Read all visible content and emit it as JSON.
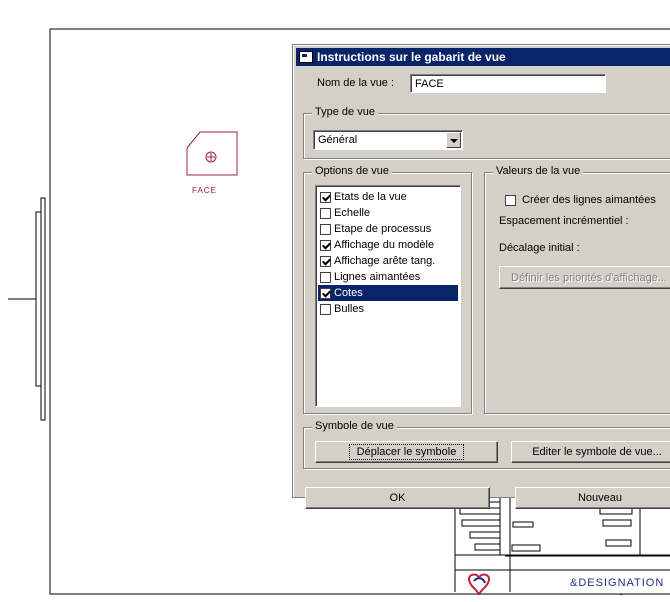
{
  "drawing": {
    "view_label": "FACE",
    "title_block_text": "&DESIGNATION",
    "title_block_dash": "-"
  },
  "dialog": {
    "title": "Instructions sur le gabarit de vue",
    "view_name_label": "Nom de la vue :",
    "view_name_value": "FACE",
    "view_type_group": "Type de vue",
    "view_type_value": "Général",
    "view_options_group": "Options de vue",
    "view_options": [
      {
        "label": "Etats de la vue",
        "checked": true,
        "selected": false
      },
      {
        "label": "Echelle",
        "checked": false,
        "selected": false
      },
      {
        "label": "Etape de processus",
        "checked": false,
        "selected": false
      },
      {
        "label": "Affichage du modèle",
        "checked": true,
        "selected": false
      },
      {
        "label": "Affichage arête tang.",
        "checked": true,
        "selected": false
      },
      {
        "label": "Lignes aimantées",
        "checked": false,
        "selected": false
      },
      {
        "label": "Cotes",
        "checked": true,
        "selected": true
      },
      {
        "label": "Bulles",
        "checked": false,
        "selected": false
      }
    ],
    "view_values_group": "Valeurs de la vue",
    "create_snap_lines_label": "Créer des lignes aimantées",
    "incremental_spacing_label": "Espacement incrémentiel :",
    "initial_offset_label": "Décalage initial :",
    "define_display_priorities_label": "Définir les priorités d'affichage...",
    "view_symbol_group": "Symbole de vue",
    "move_symbol_label": "Déplacer le symbole",
    "edit_view_symbol_label": "Editer le symbole de vue...",
    "ok_label": "OK",
    "new_label": "Nouveau"
  },
  "colors": {
    "titlebar": "#0a246a",
    "dialog_bg": "#d4d0c8",
    "view_symbol": "#a0203c",
    "selection": "#0a246a"
  }
}
